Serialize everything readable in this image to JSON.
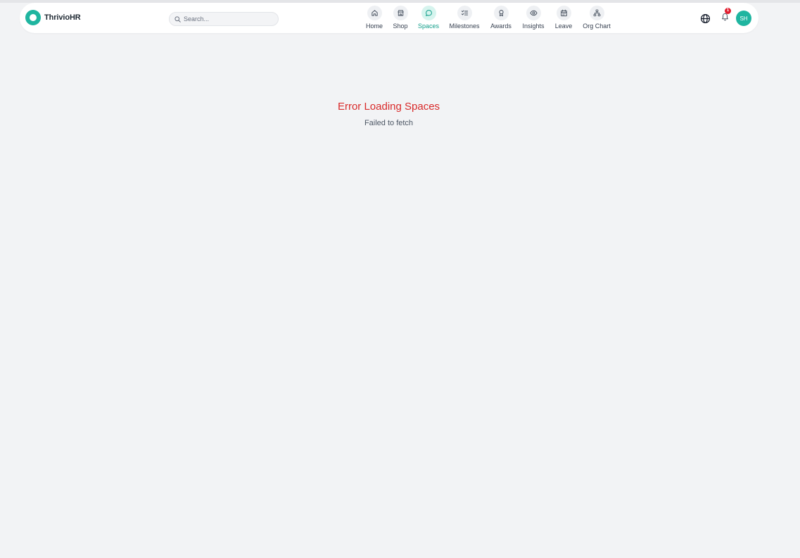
{
  "app": {
    "name": "ThrivioHR",
    "brand_color": "#1fb5a0"
  },
  "search": {
    "placeholder": "Search..."
  },
  "nav": {
    "active": "Spaces",
    "items": [
      {
        "label": "Home",
        "icon": "home-icon"
      },
      {
        "label": "Shop",
        "icon": "store-icon"
      },
      {
        "label": "Spaces",
        "icon": "chat-bubble-icon"
      },
      {
        "label": "Milestones",
        "icon": "checklist-icon"
      },
      {
        "label": "Awards",
        "icon": "award-icon"
      },
      {
        "label": "Insights",
        "icon": "eye-icon"
      },
      {
        "label": "Leave",
        "icon": "calendar-icon"
      },
      {
        "label": "Org Chart",
        "icon": "org-chart-icon"
      }
    ]
  },
  "header_right": {
    "notification_count": "1",
    "avatar_initials": "SH"
  },
  "error": {
    "title": "Error Loading Spaces",
    "message": "Failed to fetch",
    "color": "#d92a2a"
  }
}
